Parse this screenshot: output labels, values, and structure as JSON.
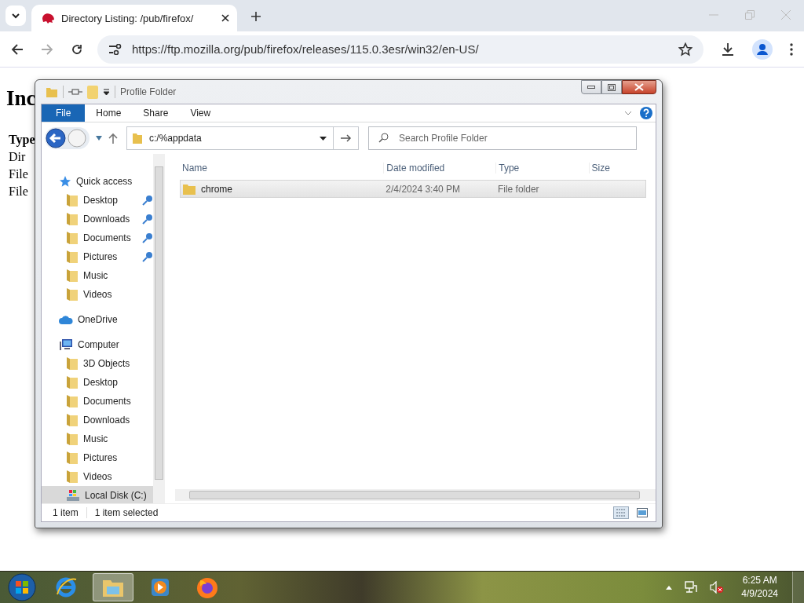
{
  "browser": {
    "tabs": [
      {
        "title": "Directory Listing: /pub/firefox/",
        "selected": true
      }
    ],
    "url": "https://ftp.mozilla.org/pub/firefox/releases/115.0.3esr/win32/en-US/"
  },
  "page": {
    "heading": "Inc",
    "lines": [
      {
        "text": "Type",
        "kind": "header"
      },
      {
        "text": "Dir",
        "kind": "row"
      },
      {
        "text": "File",
        "kind": "row"
      },
      {
        "text": "File",
        "kind": "row"
      }
    ]
  },
  "explorer": {
    "title": "Profile Folder",
    "ribbon_tabs": [
      {
        "label": "File",
        "selected": true
      },
      {
        "label": "Home",
        "selected": false
      },
      {
        "label": "Share",
        "selected": false
      },
      {
        "label": "View",
        "selected": false
      }
    ],
    "address": "c:/%appdata",
    "search": {
      "placeholder": "Search Profile Folder"
    },
    "nav": [
      {
        "label": "Quick access",
        "kind": "quick",
        "selected": false,
        "children": [
          {
            "label": "Desktop",
            "kind": "folder",
            "pinned": true,
            "selected": false
          },
          {
            "label": "Downloads",
            "kind": "folder",
            "pinned": true,
            "selected": false
          },
          {
            "label": "Documents",
            "kind": "folder",
            "pinned": true,
            "selected": false
          },
          {
            "label": "Pictures",
            "kind": "folder",
            "pinned": true,
            "selected": false
          },
          {
            "label": "Music",
            "kind": "folder",
            "pinned": false,
            "selected": false
          },
          {
            "label": "Videos",
            "kind": "folder",
            "pinned": false,
            "selected": false
          }
        ]
      },
      {
        "label": "OneDrive",
        "kind": "cloud",
        "selected": false
      },
      {
        "label": "Computer",
        "kind": "computer",
        "selected": false,
        "children": [
          {
            "label": "3D Objects",
            "kind": "folder",
            "pinned": false,
            "selected": false
          },
          {
            "label": "Desktop",
            "kind": "folder",
            "pinned": false,
            "selected": false
          },
          {
            "label": "Documents",
            "kind": "folder",
            "pinned": false,
            "selected": false
          },
          {
            "label": "Downloads",
            "kind": "folder",
            "pinned": false,
            "selected": false
          },
          {
            "label": "Music",
            "kind": "folder",
            "pinned": false,
            "selected": false
          },
          {
            "label": "Pictures",
            "kind": "folder",
            "pinned": false,
            "selected": false
          },
          {
            "label": "Videos",
            "kind": "folder",
            "pinned": false,
            "selected": false
          },
          {
            "label": "Local Disk (C:)",
            "kind": "drive",
            "pinned": false,
            "selected": true
          }
        ]
      }
    ],
    "columns": [
      "Name",
      "Date modified",
      "Type",
      "Size"
    ],
    "rows": [
      {
        "name": "chrome",
        "date": "2/4/2024 3:40 PM",
        "type": "File folder",
        "selected": true
      }
    ],
    "status": [
      "1 item",
      "1 item selected"
    ]
  },
  "taskbar": {
    "time": "6:25 AM",
    "date": "4/9/2024"
  }
}
